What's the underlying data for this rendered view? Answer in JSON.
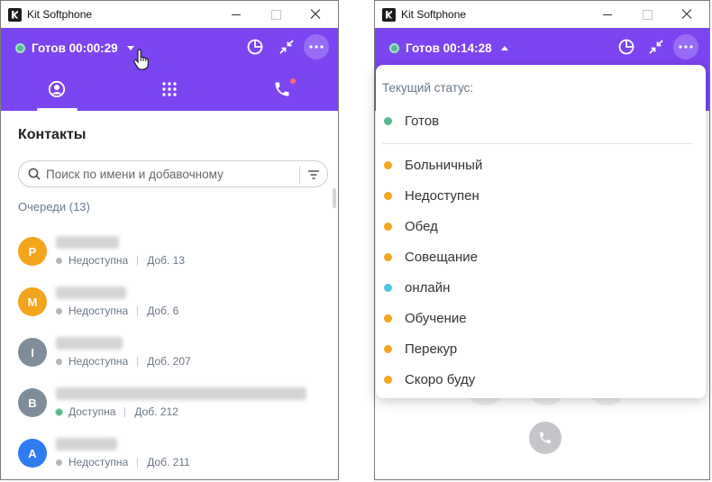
{
  "app": {
    "title": "Kit Softphone"
  },
  "left": {
    "status_text": "Готов 00:00:29",
    "tabs": [
      {
        "icon": "contacts-icon"
      },
      {
        "icon": "dialpad-icon"
      },
      {
        "icon": "call-history-icon"
      }
    ],
    "section_title": "Контакты",
    "search": {
      "placeholder": "Поиск по имени и добавочному"
    },
    "queues_label": "Очереди (13)",
    "contacts": [
      {
        "initial": "P",
        "color": "#f2a51d",
        "status": "Недоступна",
        "status_color": "gray",
        "ext": "Доб. 13"
      },
      {
        "initial": "M",
        "color": "#f2a51d",
        "status": "Недоступна",
        "status_color": "gray",
        "ext": "Доб. 6"
      },
      {
        "initial": "I",
        "color": "#7e8d99",
        "status": "Недоступна",
        "status_color": "gray",
        "ext": "Доб. 207"
      },
      {
        "initial": "B",
        "color": "#7e8d99",
        "status": "Доступна",
        "status_color": "green",
        "ext": "Доб. 212"
      },
      {
        "initial": "A",
        "color": "#2f7bf2",
        "status": "Недоступна",
        "status_color": "gray",
        "ext": "Доб. 211"
      }
    ]
  },
  "right": {
    "status_text": "Готов 00:14:28",
    "dropdown": {
      "label": "Текущий статус:",
      "current": {
        "text": "Готов",
        "color": "#59b88f"
      },
      "options": [
        {
          "text": "Больничный",
          "color": "#f2a51d"
        },
        {
          "text": "Недоступен",
          "color": "#f2a51d"
        },
        {
          "text": "Обед",
          "color": "#f2a51d"
        },
        {
          "text": "Совещание",
          "color": "#f2a51d"
        },
        {
          "text": "онлайн",
          "color": "#4cc6e0"
        },
        {
          "text": "Обучение",
          "color": "#f2a51d"
        },
        {
          "text": "Перекур",
          "color": "#f2a51d"
        },
        {
          "text": "Скоро буду",
          "color": "#f2a51d"
        }
      ]
    }
  },
  "colors": {
    "accent": "#7b45f2",
    "ready": "#59b88f",
    "away": "#f2a51d",
    "online": "#4cc6e0"
  }
}
